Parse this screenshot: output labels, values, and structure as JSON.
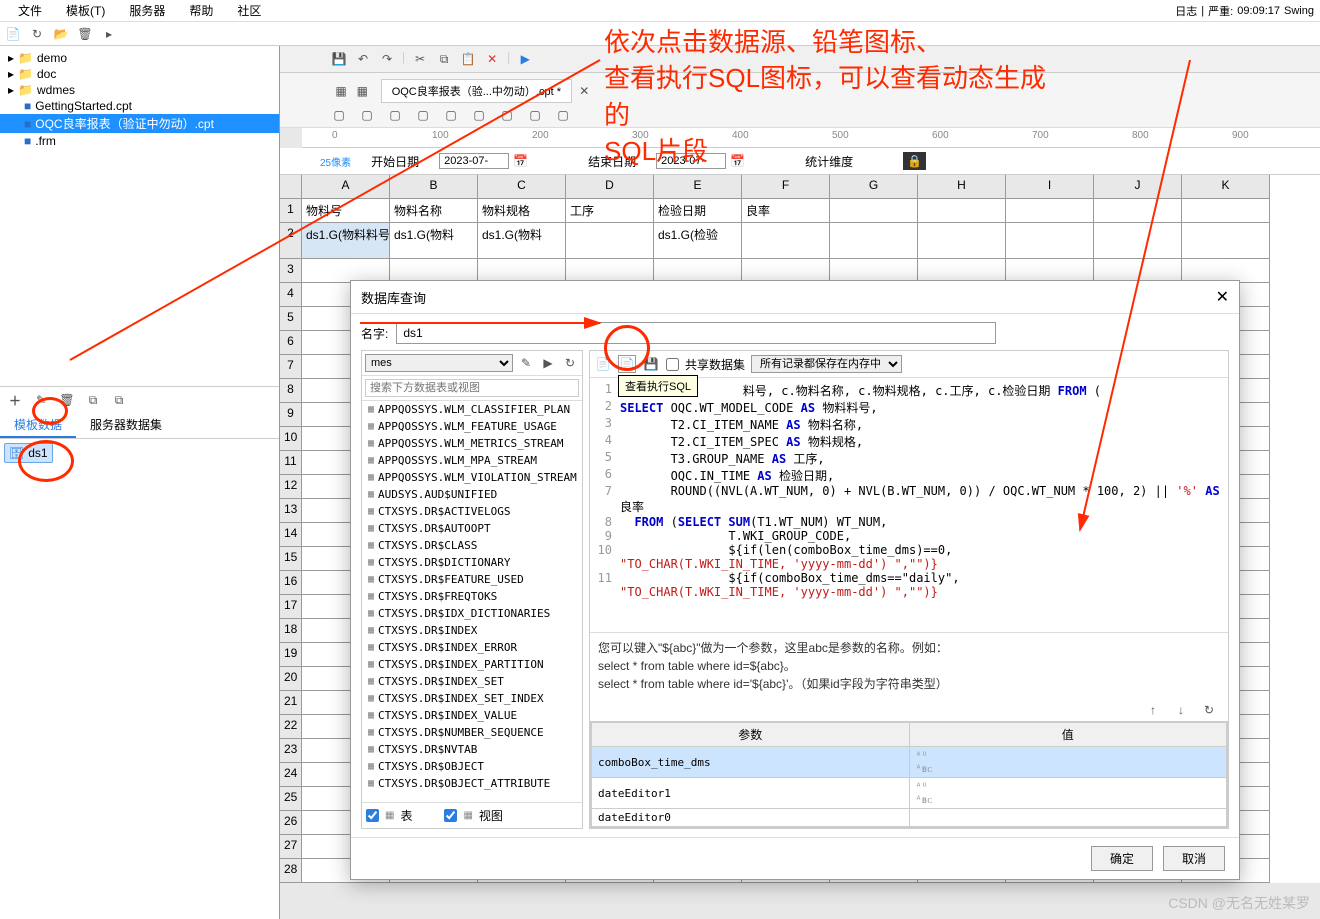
{
  "menubar": {
    "file": "文件",
    "template": "模板(T)",
    "server": "服务器",
    "help": "帮助",
    "community": "社区",
    "log": "日志",
    "severity": "严重:",
    "time": "09:09:17",
    "swing": "Swing"
  },
  "tree": {
    "items": [
      {
        "type": "folder",
        "name": "demo"
      },
      {
        "type": "folder",
        "name": "doc"
      },
      {
        "type": "folder",
        "name": "wdmes"
      },
      {
        "type": "file",
        "name": "GettingStarted.cpt"
      },
      {
        "type": "file",
        "name": "OQC良率报表（验证中勿动）.cpt",
        "selected": true
      },
      {
        "type": "file",
        "name": ".frm"
      }
    ]
  },
  "ds_tabs": {
    "tab1": "模板数据",
    "tab2": "服务器数据集"
  },
  "ds_item": "ds1",
  "doc_tab": "OQC良率报表（验...中勿动）.cpt *",
  "ruler": [
    "0",
    "100",
    "200",
    "300",
    "400",
    "500",
    "600",
    "700",
    "800",
    "900"
  ],
  "param_bar": {
    "start_label": "开始日期",
    "end_label": "结束日期",
    "stat_label": "统计维度",
    "date_val": "2023-07-",
    "px_label": "25像素"
  },
  "headers": [
    "物料号",
    "物料名称",
    "物料规格",
    "工序",
    "检验日期",
    "良率"
  ],
  "row2": [
    "ds1.G(物料料号",
    "ds1.G(物料",
    "ds1.G(物料",
    "",
    "ds1.G(检验"
  ],
  "dialog": {
    "title": "数据库查询",
    "name_label": "名字:",
    "name_value": "ds1",
    "conn": "mes",
    "search_placeholder": "搜索下方数据表或视图",
    "share_label": "共享数据集",
    "memory_label": "所有记录都保存在内存中",
    "tooltip": "查看执行SQL",
    "tables": [
      "APPQOSSYS.WLM_CLASSIFIER_PLAN",
      "APPQOSSYS.WLM_FEATURE_USAGE",
      "APPQOSSYS.WLM_METRICS_STREAM",
      "APPQOSSYS.WLM_MPA_STREAM",
      "APPQOSSYS.WLM_VIOLATION_STREAM",
      "AUDSYS.AUD$UNIFIED",
      "CTXSYS.DR$ACTIVELOGS",
      "CTXSYS.DR$AUTOOPT",
      "CTXSYS.DR$CLASS",
      "CTXSYS.DR$DICTIONARY",
      "CTXSYS.DR$FEATURE_USED",
      "CTXSYS.DR$FREQTOKS",
      "CTXSYS.DR$IDX_DICTIONARIES",
      "CTXSYS.DR$INDEX",
      "CTXSYS.DR$INDEX_ERROR",
      "CTXSYS.DR$INDEX_PARTITION",
      "CTXSYS.DR$INDEX_SET",
      "CTXSYS.DR$INDEX_SET_INDEX",
      "CTXSYS.DR$INDEX_VALUE",
      "CTXSYS.DR$NUMBER_SEQUENCE",
      "CTXSYS.DR$NVTAB",
      "CTXSYS.DR$OBJECT",
      "CTXSYS.DR$OBJECT_ATTRIBUTE"
    ],
    "filter_table": "表",
    "filter_view": "视图",
    "sql_lines": [
      {
        "n": 1,
        "parts": [
          {
            "t": "SE",
            "c": "kw"
          },
          {
            "t": "               料号, c.物料名称, c.物料规格, c.工序, c.检验日期 "
          },
          {
            "t": "FROM",
            "c": "kw"
          },
          {
            "t": " ("
          }
        ]
      },
      {
        "n": 2,
        "parts": [
          {
            "t": "SELECT",
            "c": "kw"
          },
          {
            "t": " OQC.WT_MODEL_CODE "
          },
          {
            "t": "AS",
            "c": "kw"
          },
          {
            "t": " 物料料号,"
          }
        ]
      },
      {
        "n": 3,
        "parts": [
          {
            "t": "       T2.CI_ITEM_NAME "
          },
          {
            "t": "AS",
            "c": "kw"
          },
          {
            "t": " 物料名称,"
          }
        ]
      },
      {
        "n": 4,
        "parts": [
          {
            "t": "       T2.CI_ITEM_SPEC "
          },
          {
            "t": "AS",
            "c": "kw"
          },
          {
            "t": " 物料规格,"
          }
        ]
      },
      {
        "n": 5,
        "parts": [
          {
            "t": "       T3.GROUP_NAME "
          },
          {
            "t": "AS",
            "c": "kw"
          },
          {
            "t": " 工序,"
          }
        ]
      },
      {
        "n": 6,
        "parts": [
          {
            "t": "       OQC.IN_TIME "
          },
          {
            "t": "AS",
            "c": "kw"
          },
          {
            "t": " 检验日期,"
          }
        ]
      },
      {
        "n": 7,
        "parts": [
          {
            "t": "       ROUND((NVL(A.WT_NUM, 0) + NVL(B.WT_NUM, 0)) / OQC.WT_NUM * 100, 2) || "
          },
          {
            "t": "'%'",
            "c": "str"
          },
          {
            "t": " "
          },
          {
            "t": "AS",
            "c": "kw"
          }
        ]
      },
      {
        "n": "",
        "parts": [
          {
            "t": "良率"
          }
        ]
      },
      {
        "n": 8,
        "parts": [
          {
            "t": "  FROM",
            "c": "kw"
          },
          {
            "t": " ("
          },
          {
            "t": "SELECT SUM",
            "c": "kw"
          },
          {
            "t": "(T1.WT_NUM) WT_NUM,"
          }
        ]
      },
      {
        "n": 9,
        "parts": [
          {
            "t": "               T.WKI_GROUP_CODE,"
          }
        ]
      },
      {
        "n": 10,
        "parts": [
          {
            "t": "               ${if(len(comboBox_time_dms)==0,"
          }
        ]
      },
      {
        "n": "",
        "parts": [
          {
            "t": "\"TO_CHAR(T.WKI_IN_TIME, 'yyyy-mm-dd') \",\"\")}",
            "c": "str"
          }
        ]
      },
      {
        "n": 11,
        "parts": [
          {
            "t": "               ${if(comboBox_time_dms==\"daily\","
          }
        ]
      },
      {
        "n": "",
        "parts": [
          {
            "t": "\"TO_CHAR(T.WKI_IN_TIME, 'yyyy-mm-dd') \",\"\")}",
            "c": "str"
          }
        ]
      }
    ],
    "help": {
      "line1": "您可以键入\"${abc}\"做为一个参数，这里abc是参数的名称。例如：",
      "line2": "select * from table where id=${abc}。",
      "line3": "select * from table where id='${abc}'。（如果id字段为字符串类型）"
    },
    "param_header": {
      "col1": "参数",
      "col2": "值"
    },
    "params": [
      "comboBox_time_dms",
      "dateEditor1",
      "dateEditor0"
    ],
    "ok": "确定",
    "cancel": "取消"
  },
  "annotation": {
    "text": "依次点击数据源、铅笔图标、\n查看执行SQL图标，可以查看动态生成\n的\nSQL片段"
  },
  "watermark": "CSDN @无名无姓某罗"
}
